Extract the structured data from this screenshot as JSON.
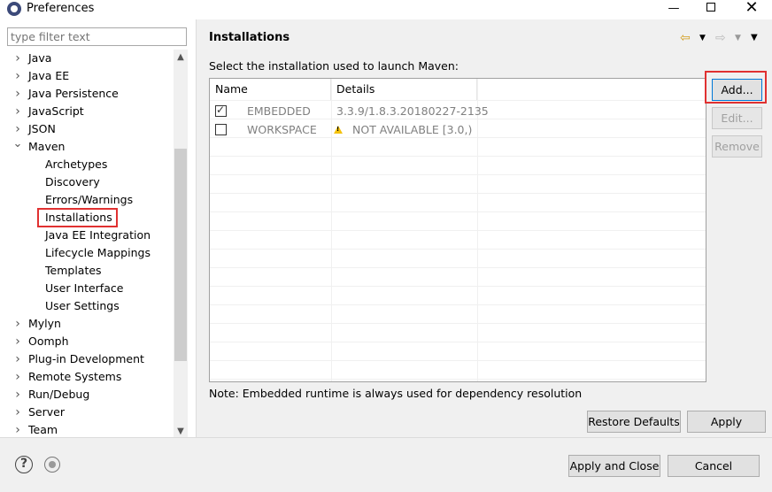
{
  "window": {
    "title": "Preferences",
    "minimize": "—",
    "close": "✕"
  },
  "left": {
    "filter_placeholder": "type filter text",
    "tree": [
      {
        "label": "Java",
        "level": 0,
        "expanded": false
      },
      {
        "label": "Java EE",
        "level": 0,
        "expanded": false
      },
      {
        "label": "Java Persistence",
        "level": 0,
        "expanded": false
      },
      {
        "label": "JavaScript",
        "level": 0,
        "expanded": false
      },
      {
        "label": "JSON",
        "level": 0,
        "expanded": false
      },
      {
        "label": "Maven",
        "level": 0,
        "expanded": true
      },
      {
        "label": "Archetypes",
        "level": 1
      },
      {
        "label": "Discovery",
        "level": 1
      },
      {
        "label": "Errors/Warnings",
        "level": 1
      },
      {
        "label": "Installations",
        "level": 1,
        "selected": true
      },
      {
        "label": "Java EE Integration",
        "level": 1
      },
      {
        "label": "Lifecycle Mappings",
        "level": 1
      },
      {
        "label": "Templates",
        "level": 1
      },
      {
        "label": "User Interface",
        "level": 1
      },
      {
        "label": "User Settings",
        "level": 1
      },
      {
        "label": "Mylyn",
        "level": 0,
        "expanded": false
      },
      {
        "label": "Oomph",
        "level": 0,
        "expanded": false
      },
      {
        "label": "Plug-in Development",
        "level": 0,
        "expanded": false
      },
      {
        "label": "Remote Systems",
        "level": 0,
        "expanded": false
      },
      {
        "label": "Run/Debug",
        "level": 0,
        "expanded": false
      },
      {
        "label": "Server",
        "level": 0,
        "expanded": false
      },
      {
        "label": "Team",
        "level": 0,
        "expanded": false
      }
    ]
  },
  "right": {
    "title": "Installations",
    "instruction": "Select the installation used to launch Maven:",
    "columns": [
      "Name",
      "Details"
    ],
    "rows": [
      {
        "checked": true,
        "name": "EMBEDDED",
        "details": "3.3.9/1.8.3.20180227-2135",
        "warning": false
      },
      {
        "checked": false,
        "name": "WORKSPACE",
        "details": "NOT AVAILABLE [3.0,)",
        "warning": true
      }
    ],
    "buttons": {
      "add": "Add...",
      "edit": "Edit...",
      "remove": "Remove",
      "restore_defaults": "Restore Defaults",
      "apply": "Apply"
    },
    "note": "Note: Embedded runtime is always used for dependency resolution"
  },
  "bottom": {
    "help": "?",
    "apply_and_close": "Apply and Close",
    "cancel": "Cancel"
  },
  "colors": {
    "highlight": "#e03131",
    "focus": "#0078d7",
    "warning": "#f4c20d"
  }
}
